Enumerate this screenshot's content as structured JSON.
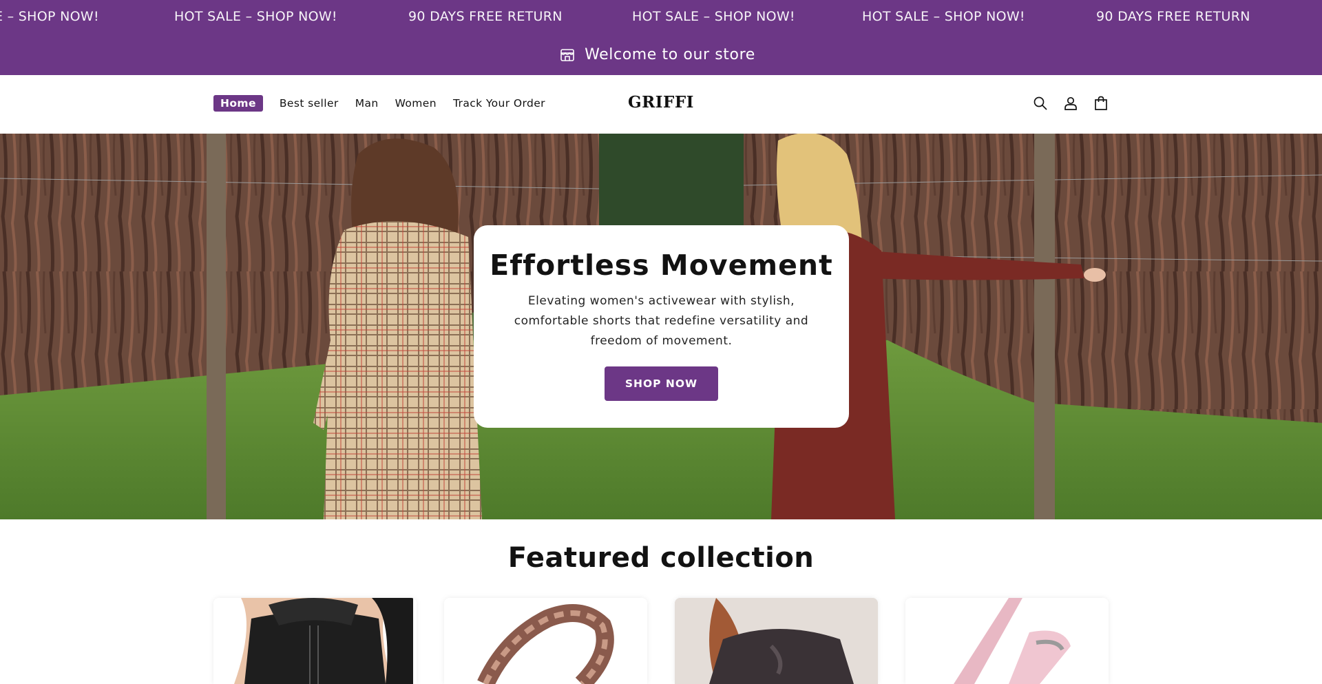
{
  "marquee": {
    "items": [
      "E – SHOP NOW!",
      "HOT SALE – SHOP NOW!",
      "90 DAYS FREE RETURN",
      "HOT SALE – SHOP NOW!",
      "HOT SALE – SHOP NOW!",
      "90 DAYS FREE RETURN"
    ]
  },
  "announcement": {
    "text": "Welcome to our store",
    "icon": "store-icon"
  },
  "nav": {
    "items": [
      {
        "label": "Home",
        "active": true
      },
      {
        "label": "Best seller"
      },
      {
        "label": "Man"
      },
      {
        "label": "Women"
      },
      {
        "label": "Track Your Order"
      }
    ]
  },
  "header": {
    "logo": "GRIFFI",
    "icons": [
      "search-icon",
      "account-icon",
      "cart-icon"
    ]
  },
  "hero": {
    "title": "Effortless Movement",
    "text": "Elevating women's activewear with stylish, comfortable shorts that redefine versatility and freedom of movement.",
    "button": "SHOP NOW"
  },
  "featured": {
    "title": "Featured collection",
    "products": [
      "product-shapewear",
      "product-bracelet",
      "product-top",
      "product-hair-tool"
    ]
  },
  "colors": {
    "brand": "#6c3786",
    "text": "#121212",
    "background": "#ffffff"
  }
}
